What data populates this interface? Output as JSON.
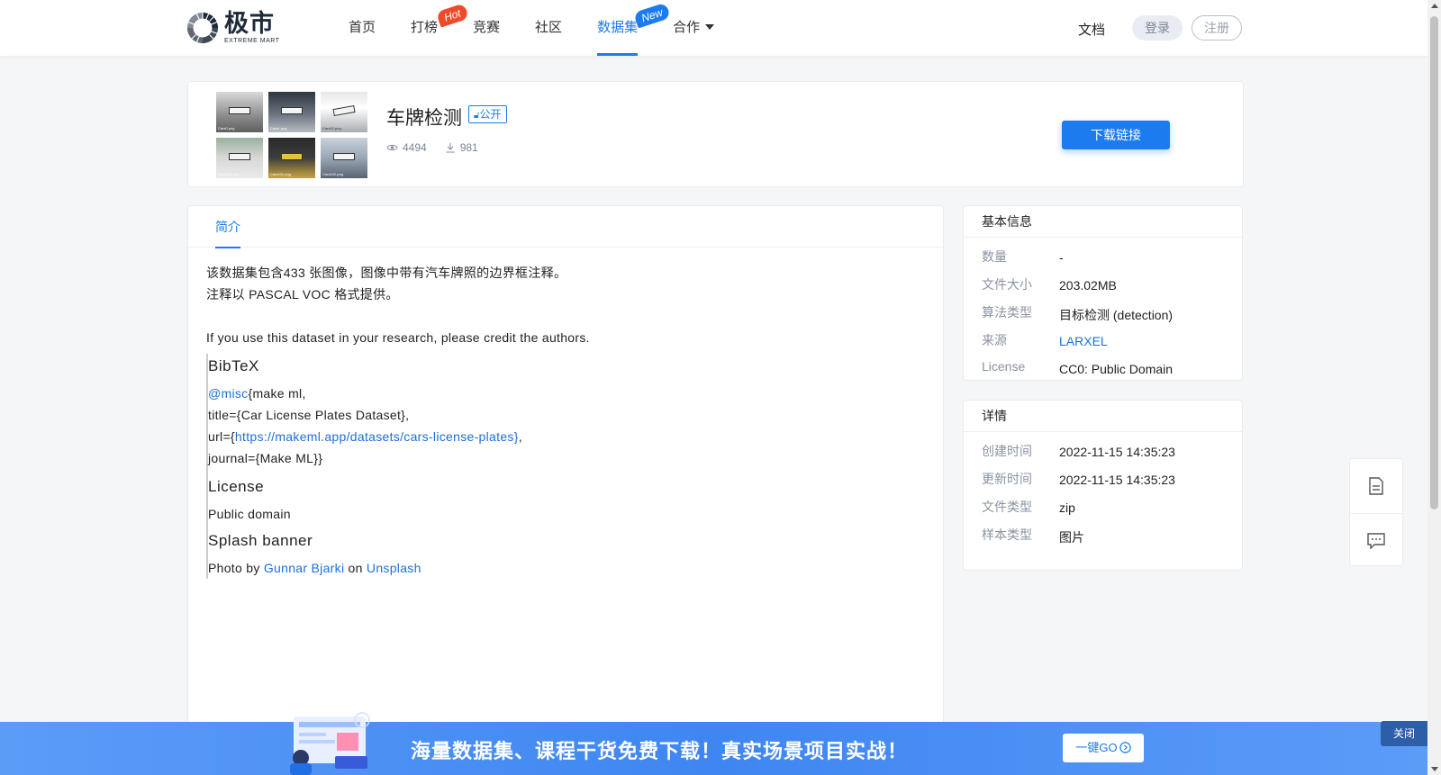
{
  "brand": {
    "name_cn": "极市",
    "name_en": "EXTREME MART"
  },
  "nav": {
    "items": [
      {
        "label": "首页"
      },
      {
        "label": "打榜",
        "badge": "Hot"
      },
      {
        "label": "竞赛"
      },
      {
        "label": "社区"
      },
      {
        "label": "数据集",
        "badge": "New",
        "active": true
      },
      {
        "label": "合作"
      }
    ],
    "docs": "文档",
    "login": "登录",
    "register": "注册"
  },
  "dataset": {
    "title": "车牌检测",
    "visibility": "公开",
    "views": "4494",
    "downloads": "981",
    "download_button": "下载链接",
    "thumb_captions": [
      "Cars0.png",
      "Cars1.png",
      "Cars10.png",
      "Cars100.png",
      "Cars101.png",
      "Cars102.png"
    ]
  },
  "tabs": [
    {
      "label": "简介"
    }
  ],
  "intro": {
    "line1": "该数据集包含433 张图像，图像中带有汽车牌照的边界框注释。",
    "line2": "注释以 PASCAL VOC 格式提供。",
    "line3": "If you use this dataset in your research, please credit the authors.",
    "bibtex_heading": "BibTeX",
    "bib_misc": "@misc",
    "bib_misc_rest": "{make ml,",
    "bib_title": "title={Car License Plates Dataset},",
    "bib_url_prefix": "url={",
    "bib_url": "https://makeml.app/datasets/cars-license-plates}",
    "bib_url_suffix": ",",
    "bib_journal": "journal={Make ML}}",
    "license_heading": "License",
    "license_text": "Public domain",
    "splash_heading": "Splash banner",
    "splash_prefix": "Photo by ",
    "splash_author": "Gunnar Bjarki",
    "splash_mid": " on ",
    "splash_site": "Unsplash"
  },
  "basic_info": {
    "heading": "基本信息",
    "rows": [
      {
        "key": "数量",
        "value": "-"
      },
      {
        "key": "文件大小",
        "value": "203.02MB"
      },
      {
        "key": "算法类型",
        "value": "目标检测 (detection)"
      },
      {
        "key": "来源",
        "value": "LARXEL"
      },
      {
        "key": "License",
        "value": "CC0: Public Domain"
      }
    ]
  },
  "details": {
    "heading": "详情",
    "rows": [
      {
        "key": "创建时间",
        "value": "2022-11-15 14:35:23"
      },
      {
        "key": "更新时间",
        "value": "2022-11-15 14:35:23"
      },
      {
        "key": "文件类型",
        "value": "zip"
      },
      {
        "key": "样本类型",
        "value": "图片"
      }
    ]
  },
  "float_tools": {
    "icons": [
      "document-icon",
      "feedback-icon"
    ]
  },
  "banner": {
    "text": "海量数据集、课程干货免费下载！真实场景项目实战！",
    "button": "一键GO",
    "close": "关闭"
  },
  "colors": {
    "accent": "#1d7bf0",
    "hot": "#f04a2b",
    "banner": "#3f86f2"
  }
}
